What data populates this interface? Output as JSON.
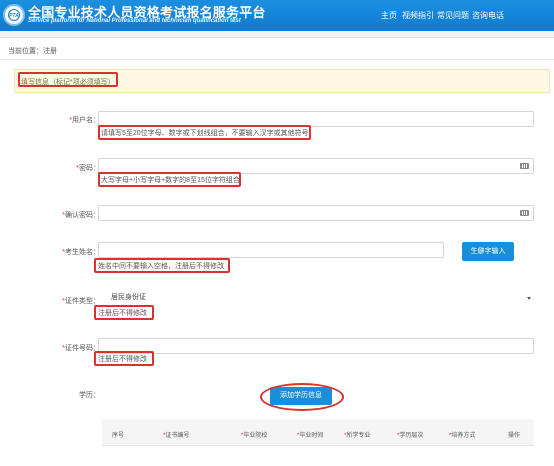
{
  "header": {
    "logo_text": "PTA",
    "title_cn": "全国专业技术人员资格考试报名服务平台",
    "title_en": "Service platform for National Professional and technician qualification test",
    "nav": [
      "主页",
      "视频指引",
      "常见问题",
      "咨询电话"
    ]
  },
  "breadcrumb": "当前位置：注册",
  "notice": "填写信息（标记*项必须填写）",
  "form": {
    "username": {
      "label": "用户名：",
      "hint": "请填写5至20位字母、数字或下划线组合，不要输入汉字或其他符号"
    },
    "password": {
      "label": "密码：",
      "hint": "大写字母+小写字母+数字的8至15位字符组合"
    },
    "confirm_password": {
      "label": "确认密码："
    },
    "name": {
      "label": "考生姓名：",
      "hint": "姓名中间不要输入空格，注册后不得修改",
      "rare_char_button": "生僻字输入"
    },
    "id_type": {
      "label": "证件类型：",
      "value": "居民身份证",
      "hint": "注册后不得修改"
    },
    "id_number": {
      "label": "证件号码：",
      "hint": "注册后不得修改"
    },
    "education": {
      "label": "学历：",
      "add_button": "添加学历信息"
    }
  },
  "table": {
    "headers": [
      "序号",
      "证书编号",
      "毕业院校",
      "毕业时间",
      "所学专业",
      "学历层次",
      "培养方式",
      "操作"
    ],
    "required": [
      false,
      true,
      true,
      true,
      true,
      true,
      true,
      false
    ]
  },
  "colors": {
    "header_blue": "#1c8fe0",
    "annotation_red": "#d9322f",
    "button_blue": "#1a8fd8"
  }
}
